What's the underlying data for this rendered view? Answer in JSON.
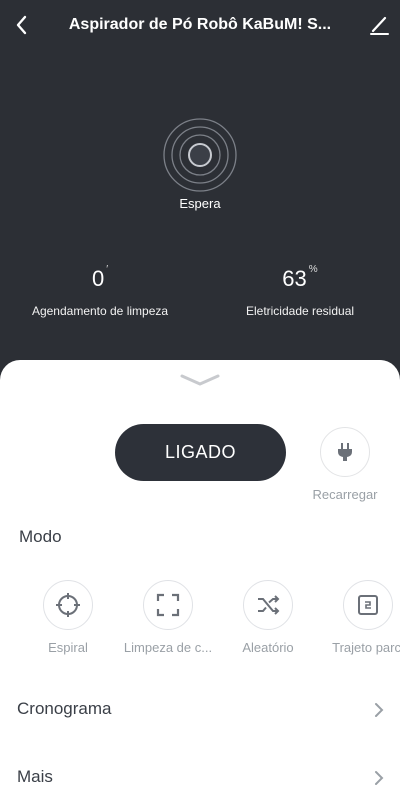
{
  "header": {
    "title": "Aspirador de Pó Robô KaBuM! S...",
    "back_icon": "chevron-left-icon",
    "edit_icon": "pencil-icon"
  },
  "status": {
    "label": "Espera"
  },
  "stats": {
    "schedule": {
      "value": "0",
      "unit": "′",
      "label": "Agendamento de limpeza"
    },
    "battery": {
      "value": "63",
      "unit": "%",
      "label": "Eletricidade residual"
    }
  },
  "controls": {
    "power_label": "LIGADO",
    "recharge_label": "Recarregar"
  },
  "modes": {
    "title": "Modo",
    "items": [
      {
        "label": "Espiral",
        "icon": "crosshair-icon"
      },
      {
        "label": "Limpeza de c...",
        "icon": "corners-icon"
      },
      {
        "label": "Aleatório",
        "icon": "shuffle-icon"
      },
      {
        "label": "Trajeto parci",
        "icon": "partial-route-icon"
      }
    ]
  },
  "menu": {
    "schedule_label": "Cronograma",
    "more_label": "Mais"
  },
  "colors": {
    "background": "#2c2f35",
    "panel": "#ffffff",
    "button": "#2d3139",
    "muted": "#9aa0a6"
  }
}
